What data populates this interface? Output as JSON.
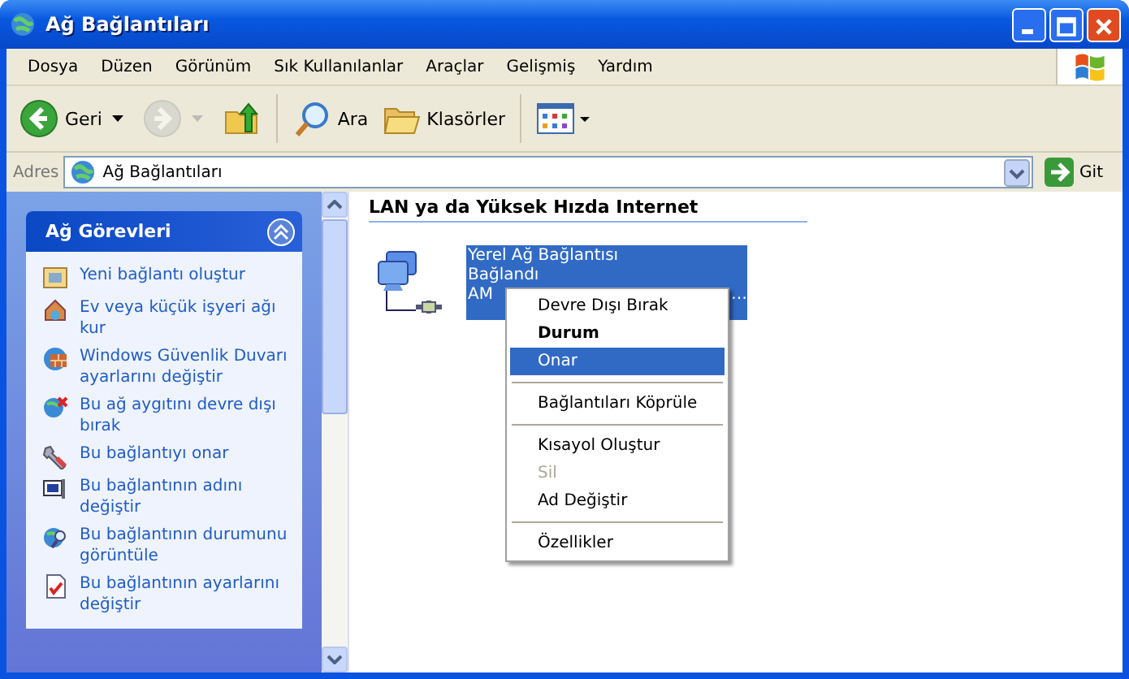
{
  "window": {
    "title": "Ağ Bağlantıları"
  },
  "menu_bar": [
    "Dosya",
    "Düzen",
    "Görünüm",
    "Sık Kullanılanlar",
    "Araçlar",
    "Gelişmiş",
    "Yardım"
  ],
  "toolbar": [
    {
      "kind": "back",
      "label": "Geri",
      "disabled": false
    },
    {
      "kind": "forward",
      "disabled": true
    },
    {
      "kind": "up",
      "disabled": false
    },
    {
      "kind": "search",
      "label": "Ara",
      "disabled": false
    },
    {
      "kind": "folders",
      "label": "Klasörler",
      "disabled": false
    },
    {
      "kind": "views",
      "disabled": false
    }
  ],
  "address_bar": {
    "label": "Adres",
    "value": "Ağ Bağlantıları",
    "go_button": "Git"
  },
  "task_pane": {
    "title": "Ağ Görevleri",
    "expanded": true,
    "tasks": [
      {
        "kind": "new",
        "label": "Yeni bağlantı oluştur"
      },
      {
        "kind": "home",
        "label": "Ev veya küçük işyeri ağı kur"
      },
      {
        "kind": "firewall",
        "label": "Windows Güvenlik Duvarı ayarlarını değiştir"
      },
      {
        "kind": "disable",
        "label": "Bu ağ aygıtını devre dışı bırak"
      },
      {
        "kind": "repair",
        "label": "Bu bağlantıyı onar"
      },
      {
        "kind": "rename",
        "label": "Bu bağlantının adını değiştir"
      },
      {
        "kind": "status",
        "label": "Bu bağlantının durumunu görüntüle"
      },
      {
        "kind": "settings",
        "label": "Bu bağlantının ayarlarını değiştir"
      }
    ]
  },
  "content": {
    "group_header": "LAN ya da Yüksek Hızda Internet",
    "items": [
      {
        "lines": [
          "Yerel Ağ Bağlantısı",
          "Bağlandı"
        ],
        "tail_start": "AM",
        "tail_end": "…",
        "selected": true
      }
    ]
  },
  "context_menu": {
    "items": [
      {
        "kind": "item",
        "label": "Devre Dışı Bırak",
        "default": false,
        "disabled": false,
        "selected": false
      },
      {
        "kind": "item",
        "label": "Durum",
        "default": true,
        "disabled": false,
        "selected": false
      },
      {
        "kind": "item",
        "label": "Onar",
        "default": false,
        "disabled": false,
        "selected": true
      },
      {
        "kind": "separator"
      },
      {
        "kind": "item",
        "label": "Bağlantıları Köprüle",
        "default": false,
        "disabled": false,
        "selected": false
      },
      {
        "kind": "separator"
      },
      {
        "kind": "item",
        "label": "Kısayol Oluştur",
        "default": false,
        "disabled": false,
        "selected": false
      },
      {
        "kind": "item",
        "label": "Sil",
        "default": false,
        "disabled": true,
        "selected": false
      },
      {
        "kind": "item",
        "label": "Ad Değiştir",
        "default": false,
        "disabled": false,
        "selected": false
      },
      {
        "kind": "separator"
      },
      {
        "kind": "item",
        "label": "Özellikler",
        "default": false,
        "disabled": false,
        "selected": false
      }
    ]
  }
}
